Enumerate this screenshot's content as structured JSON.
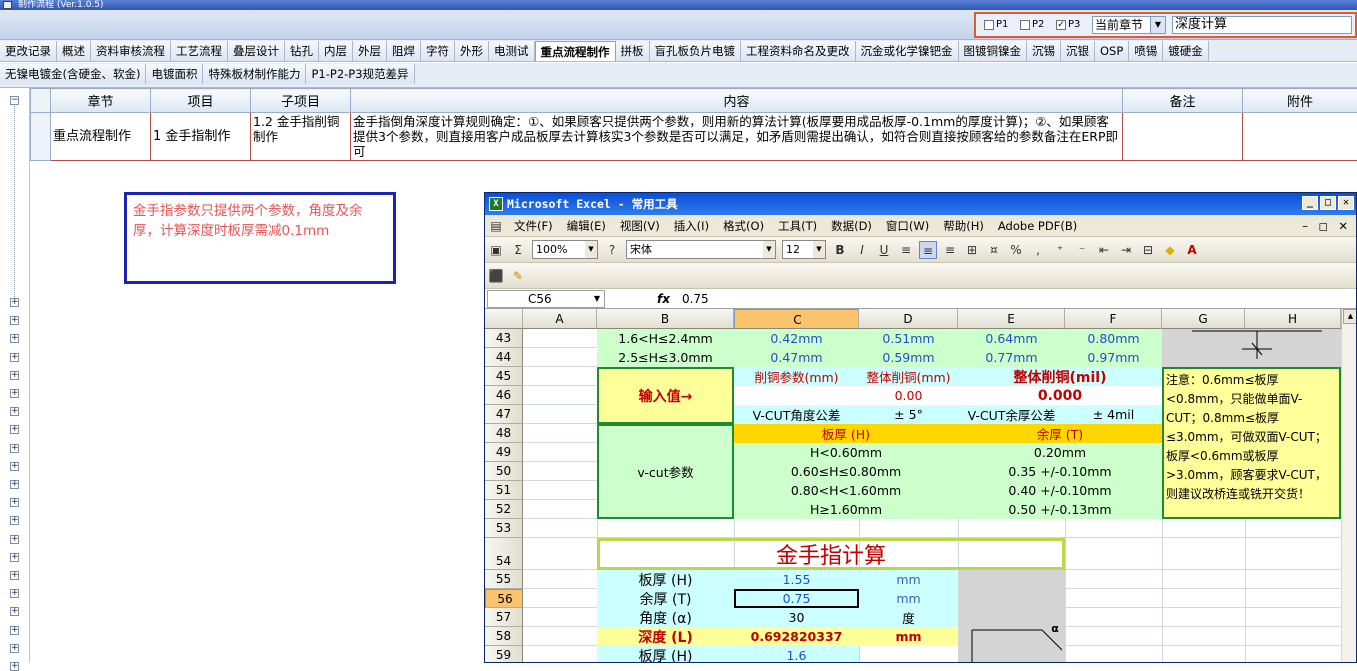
{
  "window": {
    "title": "制作流程 (Ver.1.0.5)"
  },
  "filters": {
    "checkboxes": [
      {
        "label": "P1",
        "checked": false
      },
      {
        "label": "P2",
        "checked": false
      },
      {
        "label": "P3",
        "checked": true
      }
    ],
    "scope_select": "当前章节",
    "search_value": "深度计算"
  },
  "tabs_row1": [
    "更改记录",
    "概述",
    "资料审核流程",
    "工艺流程",
    "叠层设计",
    "钻孔",
    "内层",
    "外层",
    "阻焊",
    "字符",
    "外形",
    "电测试",
    "重点流程制作",
    "拼板",
    "盲孔板负片电镀",
    "工程资料命名及更改",
    "沉金或化学镍钯金",
    "图镀铜镍金",
    "沉锡",
    "沉银",
    "OSP",
    "喷锡",
    "镀硬金"
  ],
  "tabs_row2": [
    "无镍电镀金(含硬金、软金)",
    "电镀面积",
    "特殊板材制作能力",
    "P1-P2-P3规范差异"
  ],
  "active_tab": "重点流程制作",
  "grid": {
    "headers": [
      "章节",
      "项目",
      "子项目",
      "内容",
      "备注",
      "附件"
    ],
    "rows": [
      {
        "chapter": "重点流程制作",
        "item": "1 金手指制作",
        "subitem": "1.2 金手指削铜制作",
        "content": "金手指倒角深度计算规则确定：①、如果顾客只提供两个参数，则用新的算法计算(板厚要用成品板厚-0.1mm的厚度计算)；②、如果顾客提供3个参数，则直接用客户成品板厚去计算核实3个参数是否可以满足，如矛盾则需提出确认，如符合则直接按顾客给的参数备注在ERP即可",
        "remark": "",
        "attachment": ""
      }
    ]
  },
  "annotation": "金手指参数只提供两个参数，角度及余厚，计算深度时板厚需减0.1mm",
  "excel": {
    "title": "Microsoft Excel - 常用工具",
    "menus": [
      "文件(F)",
      "编辑(E)",
      "视图(V)",
      "插入(I)",
      "格式(O)",
      "工具(T)",
      "数据(D)",
      "窗口(W)",
      "帮助(H)",
      "Adobe PDF(B)"
    ],
    "zoom": "100%",
    "font": "宋体",
    "font_size": "12",
    "name_box": "C56",
    "formula": "0.75",
    "columns": [
      "A",
      "B",
      "C",
      "D",
      "E",
      "F",
      "G",
      "H"
    ],
    "selected_column": "C",
    "selected_row": "56",
    "rows": [
      "43",
      "44",
      "45",
      "46",
      "47",
      "48",
      "49",
      "50",
      "51",
      "52",
      "53",
      "54",
      "55",
      "56",
      "57",
      "58",
      "59"
    ],
    "cells": {
      "r43b": "1.6<H≤2.4mm",
      "r43c": "0.42mm",
      "r43d": "0.51mm",
      "r43e": "0.64mm",
      "r43f": "0.80mm",
      "r44b": "2.5≤H≤3.0mm",
      "r44c": "0.47mm",
      "r44d": "0.59mm",
      "r44e": "0.77mm",
      "r44f": "0.97mm",
      "input_label": "输入值→",
      "r45c": "削铜参数(mm)",
      "r45d": "整体削铜(mm)",
      "r45e": "整体削铜(mil)",
      "r46d": "0.00",
      "r46e": "0.000",
      "r47c": "V-CUT角度公差",
      "r47d": "± 5°",
      "r47e": "V-CUT余厚公差",
      "r47f": "± 4mil",
      "vcut_label": "v-cut参数",
      "r48c": "板厚 (H)",
      "r48e": "余厚 (T)",
      "r49c": "H<0.60mm",
      "r49e": "0.20mm",
      "r50c": "0.60≤H≤0.80mm",
      "r50e": "0.35 +/-0.10mm",
      "r51c": "0.80<H<1.60mm",
      "r51e": "0.40 +/-0.10mm",
      "r52c": "H≥1.60mm",
      "r52e": "0.50 +/-0.13mm",
      "note_g": "注意：0.6mm≤板厚<0.8mm，只能做单面V-CUT；0.8mm≤板厚≤3.0mm，可做双面V-CUT；板厚<0.6mm或板厚>3.0mm，顾客要求V-CUT，则建议改桥连或铣开交货！",
      "calc_title": "金手指计算",
      "r55b": "板厚 (H)",
      "r55c": "1.55",
      "r55d": "mm",
      "r56b": "余厚 (T)",
      "r56c": "0.75",
      "r56d": "mm",
      "r57b": "角度 (α)",
      "r57c": "30",
      "r57d": "度",
      "r58b": "深度 (L)",
      "r58c": "0.692820337",
      "r58d": "mm",
      "r59b": "板厚 (H)",
      "r59c": "1.6",
      "alpha": "α"
    }
  },
  "colors": {
    "accent": "#e35a2a",
    "note_border": "#1d24b4",
    "note_text": "#e65454",
    "grid_border": "#b74a4a",
    "xl_green": "#1f8a2f",
    "xl_yellow": "#ffff99",
    "xl_cyan": "#ccffff",
    "xl_light_green": "#ccffcc"
  }
}
